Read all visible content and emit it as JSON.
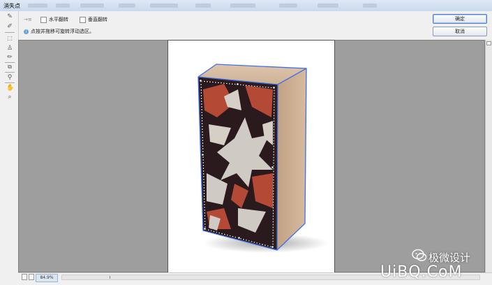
{
  "window": {
    "title": "消失点"
  },
  "options": {
    "flip_h_label": "水平翻转",
    "flip_v_label": "垂直翻转",
    "hint": "点按并拖移可旋转浮动选区。"
  },
  "buttons": {
    "ok": "确定",
    "cancel": "取消"
  },
  "tools": [
    "edit-plane-icon",
    "create-plane-icon",
    "marquee-icon",
    "stamp-icon",
    "brush-icon",
    "transform-icon",
    "eyedropper-icon",
    "hand-icon",
    "zoom-icon"
  ],
  "status": {
    "zoom": "84.9%"
  },
  "watermark": {
    "site_name": "极微设计",
    "logo": "UiBQ.CoM"
  },
  "colors": {
    "canvas_bg": "#9e9e9e",
    "box_side": "#c7a88a",
    "plane_outline": "#3f6ee8",
    "leaf_dark": "#2e1c1f",
    "leaf_red": "#b44a35"
  }
}
